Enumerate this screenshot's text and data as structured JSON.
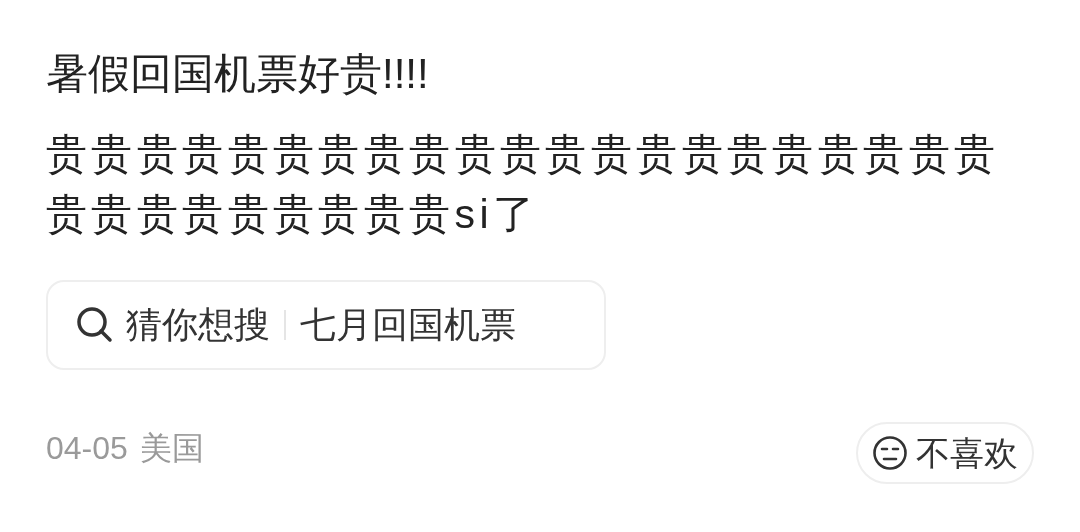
{
  "post": {
    "title": "暑假回国机票好贵!!!!",
    "body": "贵贵贵贵贵贵贵贵贵贵贵贵贵贵贵贵贵贵贵贵贵贵贵贵贵贵贵贵贵贵si了"
  },
  "search_suggestion": {
    "label": "猜你想搜",
    "query": "七月回国机票"
  },
  "meta": {
    "date": "04-05",
    "location": "美国"
  },
  "dislike_button": {
    "label": "不喜欢"
  }
}
